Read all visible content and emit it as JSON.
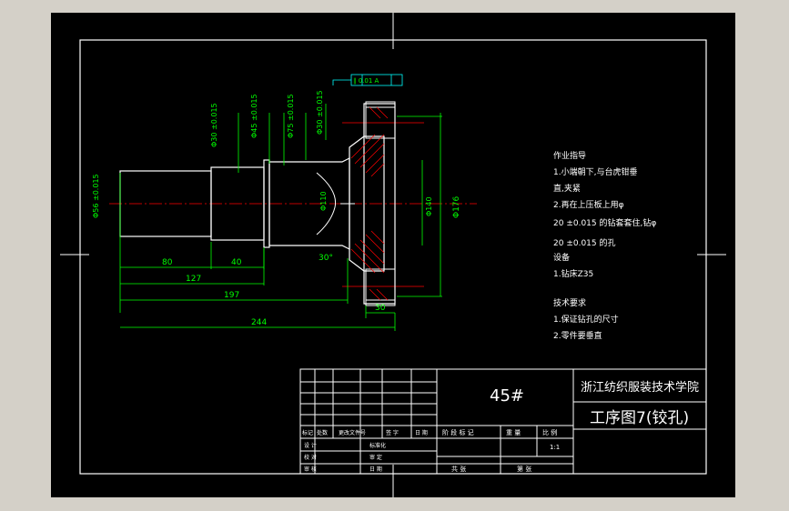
{
  "colors": {
    "background": "#000000",
    "window": "#d4d0c8",
    "frame": "#ffffff",
    "dimension": "#00ff00",
    "part": "#ffffff",
    "section_hatch": "#ff0000",
    "center_line": "#ff0000",
    "leader": "#00ffff"
  },
  "dimensions": {
    "d56": "Φ56 ±0.015",
    "d30": "Φ30 ±0.015",
    "d45": "Φ45 ±0.015",
    "d75": "Φ75 ±0.015",
    "d30_right": "Φ30 ±0.015",
    "d110": "Φ110",
    "d140": "Φ140",
    "d176": "Φ176",
    "len_80": "80",
    "len_40": "40",
    "len_127": "127",
    "len_197": "197",
    "len_244": "244",
    "len_30": "30",
    "angle": "30°",
    "tolerance_box": "∥ 0.01 A"
  },
  "instructions": {
    "title": "作业指导",
    "items": [
      "1.小端朝下,与台虎钳垂",
      "直,夹紧",
      "2.再在上压板上用φ",
      "20 ±0.015 的钻套套住,钻φ",
      "20 ±0.015 的孔",
      "设备",
      "1.钻床Z35"
    ]
  },
  "requirements": {
    "title": "技术要求",
    "items": [
      "1.保证钻孔的尺寸",
      "2.零件要垂直"
    ]
  },
  "title_block": {
    "material": "45#",
    "school": "浙江纺织服装技术学院",
    "drawing_name": "工序图7(铰孔)",
    "scale_value": "1:1",
    "col_headers": [
      "标记",
      "处数",
      "更改文件号",
      "签 字",
      "日 期"
    ],
    "row_labels": [
      "设 计",
      "校 对",
      "审 核",
      "工 艺"
    ],
    "standardize": "标准化",
    "approve": "审 定",
    "date": "日 期",
    "stage_label": "阶 段 标 记",
    "weight_label": "重 量",
    "scale_label": "比 例",
    "sheets_total": "共 张",
    "sheet_no": "第 张"
  }
}
